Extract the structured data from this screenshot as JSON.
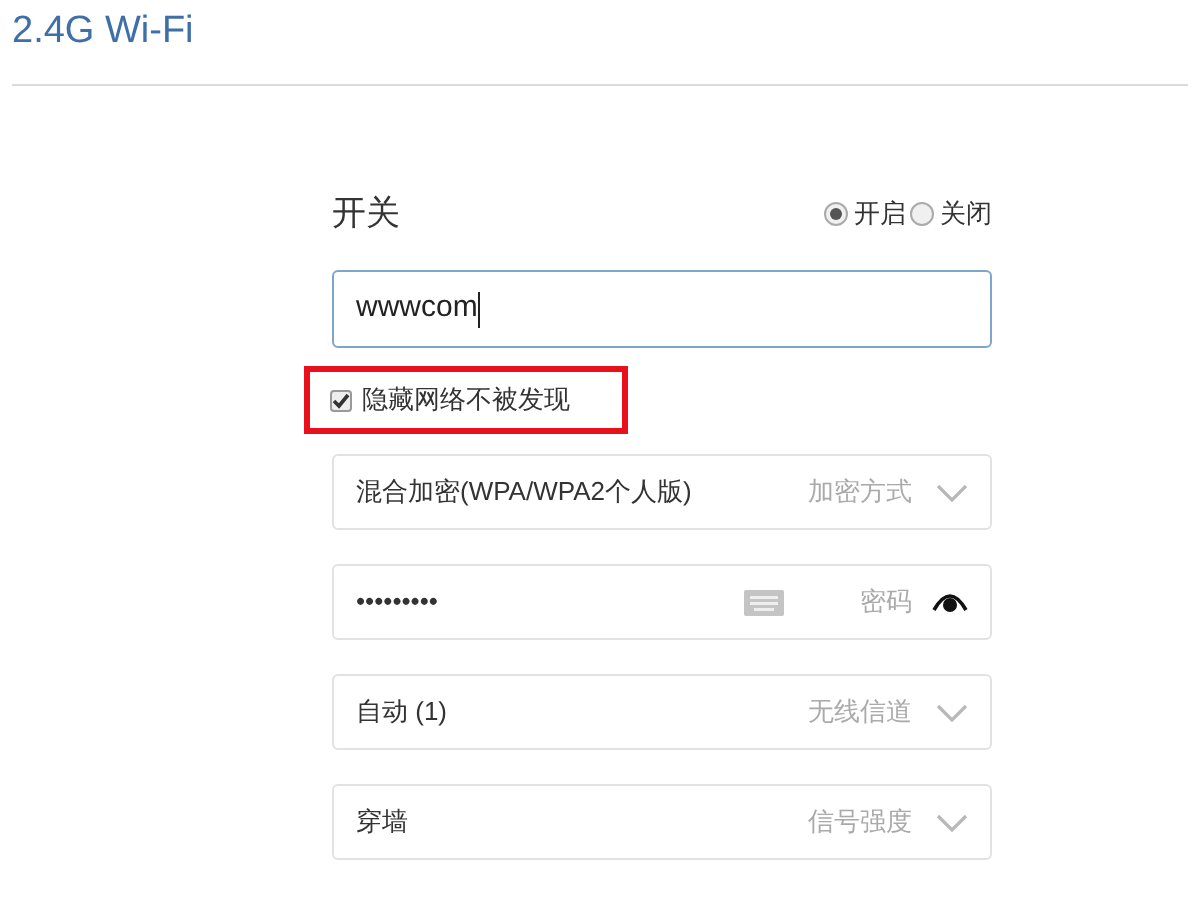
{
  "header": {
    "title": "2.4G Wi-Fi"
  },
  "switch": {
    "label": "开关",
    "options": [
      {
        "label": "开启",
        "selected": true
      },
      {
        "label": "关闭",
        "selected": false
      }
    ]
  },
  "ssid": {
    "value": "wwwcom"
  },
  "hide_network": {
    "label": "隐藏网络不被发现",
    "checked": true
  },
  "fields": [
    {
      "kind": "select",
      "value": "混合加密(WPA/WPA2个人版)",
      "label": "加密方式"
    },
    {
      "kind": "password",
      "value": "•••••••••",
      "label": "密码"
    },
    {
      "kind": "select",
      "value": "自动 (1)",
      "label": "无线信道"
    },
    {
      "kind": "select",
      "value": "穿墙",
      "label": "信号强度"
    }
  ]
}
